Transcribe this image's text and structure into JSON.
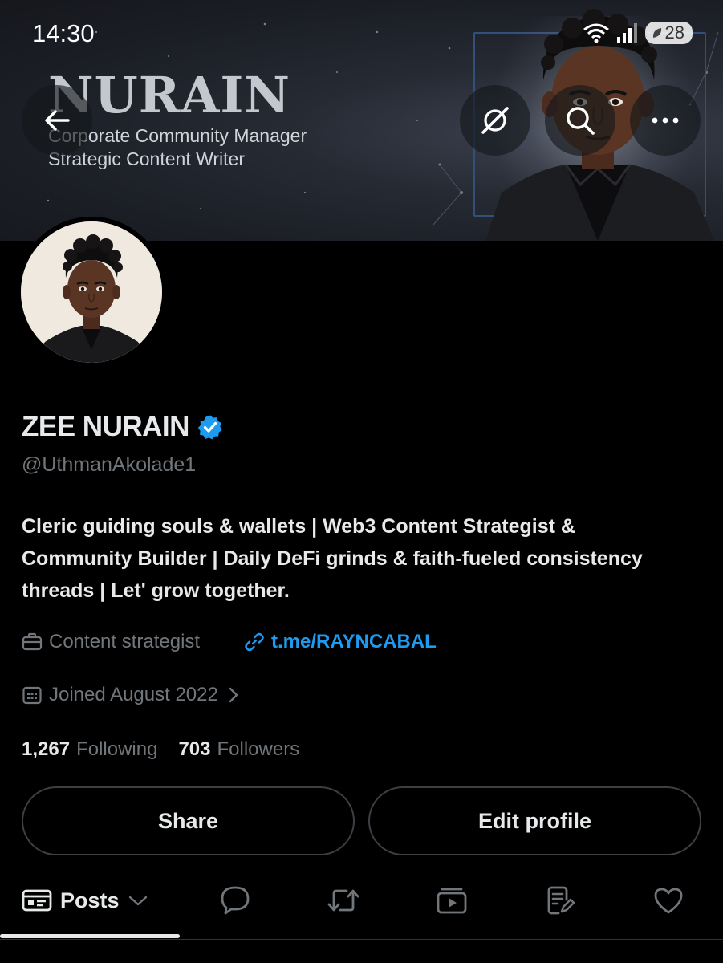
{
  "status_bar": {
    "time": "14:30",
    "battery": "28",
    "icons": [
      "wifi-icon",
      "signal-icon",
      "battery-icon"
    ]
  },
  "banner": {
    "name": "NURAIN",
    "line1": "Corporate Community Manager",
    "line2": "Strategic Content Writer"
  },
  "header_buttons": {
    "back": "back-arrow-icon",
    "grok": "grok-icon",
    "search": "search-icon",
    "more": "more-icon"
  },
  "profile": {
    "display_name": "ZEE NURAIN",
    "verified": true,
    "handle": "@UthmanAkolade1",
    "bio": "Cleric guiding souls & wallets  | Web3 Content Strategist &\nCommunity Builder | Daily DeFi grinds & faith-fueled consistency\nthreads | Let' grow together.",
    "profession": "Content strategist",
    "link": "t.me/RAYNCABAL",
    "joined": "Joined August 2022",
    "following_count": "1,267",
    "following_label": "Following",
    "followers_count": "703",
    "followers_label": "Followers"
  },
  "actions": {
    "share": "Share",
    "edit_profile": "Edit profile"
  },
  "tabs": {
    "posts": "Posts",
    "items": [
      "posts-icon",
      "replies-icon",
      "reposts-icon",
      "videos-icon",
      "articles-icon",
      "likes-icon"
    ]
  },
  "colors": {
    "background": "#000000",
    "text_primary": "#e7e9ea",
    "text_secondary": "#71767b",
    "link": "#1d9bf0",
    "verified": "#1d9bf0",
    "border": "#3b4045"
  }
}
